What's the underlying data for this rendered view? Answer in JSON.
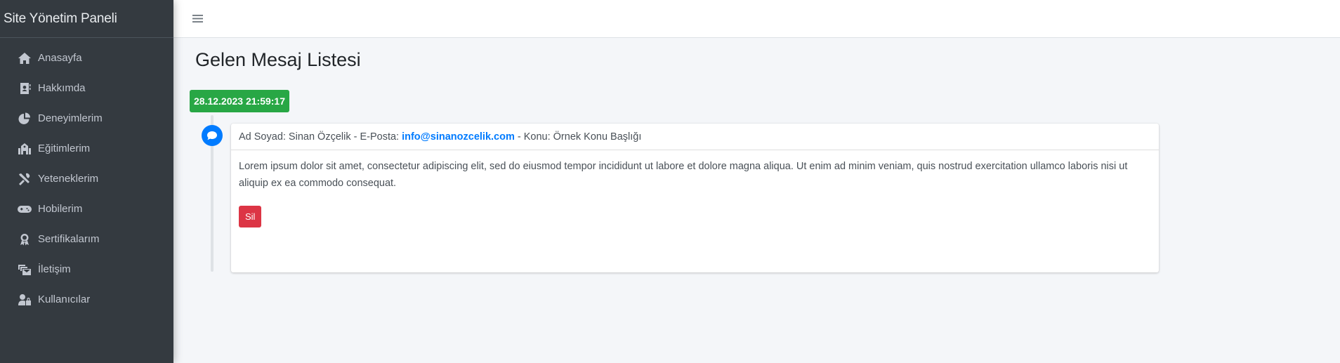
{
  "brand": {
    "title": "Site Yönetim Paneli"
  },
  "sidebar": {
    "items": [
      {
        "label": "Anasayfa",
        "icon": "home-icon"
      },
      {
        "label": "Hakkımda",
        "icon": "address-book-icon"
      },
      {
        "label": "Deneyimlerim",
        "icon": "pie-chart-icon"
      },
      {
        "label": "Eğitimlerim",
        "icon": "school-icon"
      },
      {
        "label": "Yeteneklerim",
        "icon": "tools-icon"
      },
      {
        "label": "Hobilerim",
        "icon": "gamepad-icon"
      },
      {
        "label": "Sertifikalarım",
        "icon": "award-icon"
      },
      {
        "label": "İletişim",
        "icon": "mail-bulk-icon"
      },
      {
        "label": "Kullanıcılar",
        "icon": "user-lock-icon"
      }
    ]
  },
  "topbar": {
    "menu_icon": "bars-icon"
  },
  "page": {
    "title": "Gelen Mesaj Listesi"
  },
  "timeline": {
    "time_label": "28.12.2023 21:59:17",
    "item_icon": "comment-icon",
    "message": {
      "header_prefix": "Ad Soyad: Sinan Özçelik - E-Posta:",
      "email": "info@sinanozcelik.com",
      "header_suffix": "- Konu: Örnek Konu Başlığı",
      "body": "Lorem ipsum dolor sit amet, consectetur adipiscing elit, sed do eiusmod tempor incididunt ut labore et dolore magna aliqua. Ut enim ad minim veniam, quis nostrud exercitation ullamco laboris nisi ut aliquip ex ea commodo consequat.",
      "delete_label": "Sil"
    }
  },
  "colors": {
    "sidebar_bg": "#343a40",
    "time_label_bg": "#28a745",
    "accent_blue": "#007bff",
    "danger": "#dc3545",
    "content_bg": "#f4f6f9"
  }
}
